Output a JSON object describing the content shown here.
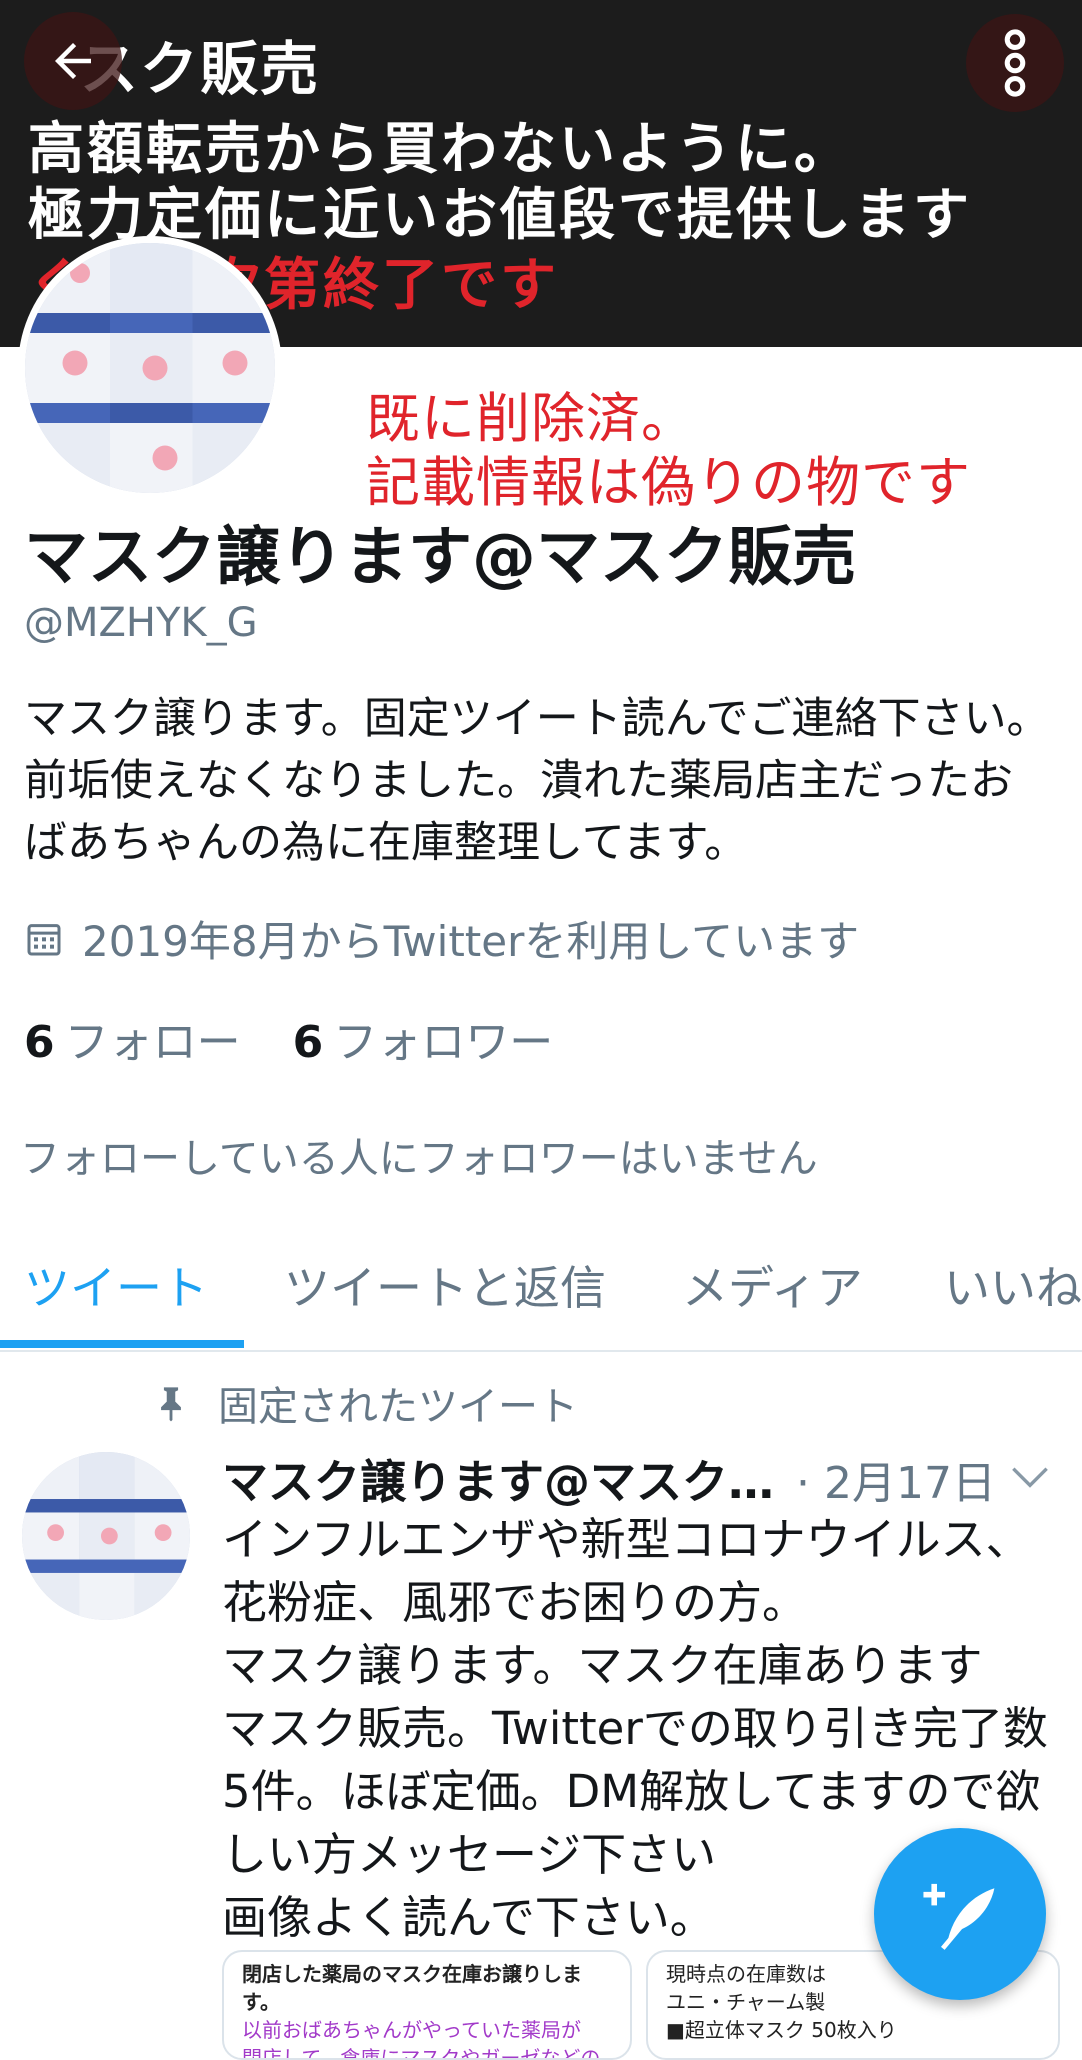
{
  "banner": {
    "line1": "スク販売",
    "line2": "高額転売から買わないように。",
    "line3": "極力定価に近いお値段で提供します",
    "line4": "くなり次第終了です"
  },
  "overlay_note": {
    "line1": "既に削除済。",
    "line2": "記載情報は偽りの物です"
  },
  "profile": {
    "display_name": "マスク譲ります@マスク販売",
    "handle": "@MZHYK_G",
    "bio": "マスク譲ります。固定ツイート読んでご連絡下さい。前垢使えなくなりました。潰れた薬局店主だったおばあちゃんの為に在庫整理してます。",
    "joined": "2019年8月からTwitterを利用しています",
    "following_count": "6",
    "following_label": "フォロー",
    "followers_count": "6",
    "followers_label": "フォロワー",
    "no_mutual_followers": "フォローしている人にフォロワーはいません"
  },
  "tabs": [
    {
      "label": "ツイート",
      "active": true
    },
    {
      "label": "ツイートと返信",
      "active": false
    },
    {
      "label": "メディア",
      "active": false
    },
    {
      "label": "いいね",
      "active": false
    }
  ],
  "pinned_tweet": {
    "pinned_label": "固定されたツイート",
    "author_name": "マスク譲ります@マスク…",
    "date": "· 2月17日",
    "body": "インフルエンザや新型コロナウイルス、\n花粉症、風邪でお困りの方。\nマスク譲ります。マスク在庫あります\nマスク販売。Twitterでの取り引き完了数5件。ほぼ定価。DM解放してますので欲しい方メッセージ下さい\n画像よく読んで下さい。",
    "image1": {
      "line1": "閉店した薬局のマスク在庫お譲りします。",
      "line2": "以前おばあちゃんがやっていた薬局が",
      "line3": "閉店して、倉庫にマスクやガーゼなどの"
    },
    "image2": {
      "line1": "現時点の在庫数は",
      "line2": "ユニ・チャーム製",
      "line3": "■超立体マスク 50枚入り"
    }
  },
  "colors": {
    "accent": "#1da1f2",
    "secondary_text": "#657786",
    "warning_red": "#e0242b",
    "banner_bg": "#1c1c1c"
  },
  "icons": {
    "back": "arrow-left-icon",
    "more": "more-vertical-icon",
    "calendar": "calendar-icon",
    "pin": "pin-icon",
    "caret": "chevron-down-icon",
    "compose": "compose-feather-icon"
  }
}
